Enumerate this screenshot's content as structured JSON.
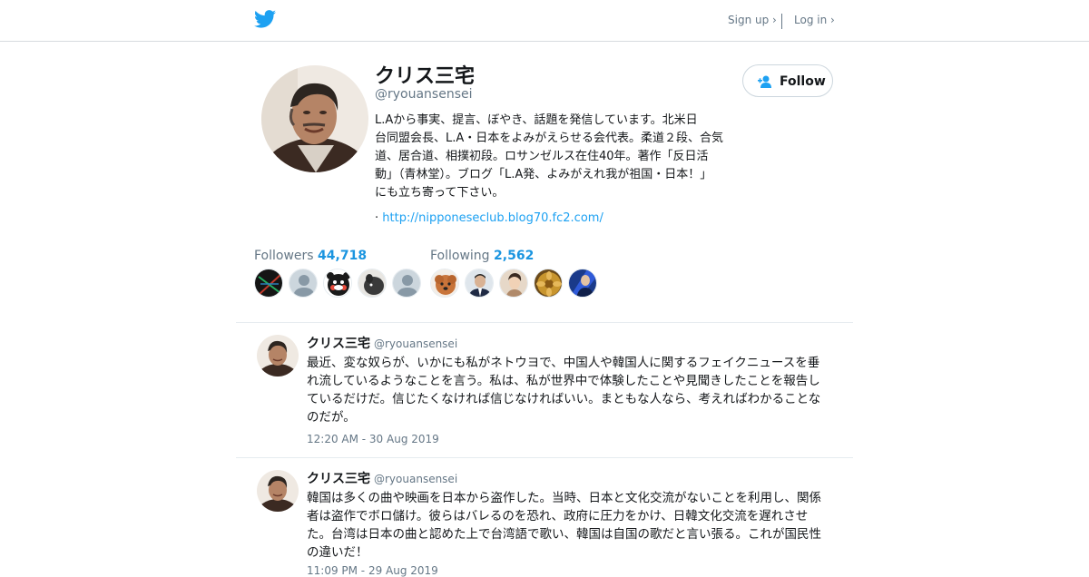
{
  "nav": {
    "signup": "Sign up ›",
    "login": "Log in ›"
  },
  "profile": {
    "name": "クリス三宅",
    "handle": "@ryouansensei",
    "follow_label": "Follow",
    "bio_lines": [
      "L.Aから事実、提言、ぼやき、話題を発信しています。北米日",
      "台同盟会長、L.A・日本をよみがえらせる会代表。柔道２段、合気",
      "道、居合道、相撲初段。ロサンゼルス在住40年。著作「反日活",
      "動」（青林堂）。ブログ「L.A発、よみがえれ我が祖国・日本！」",
      "にも立ち寄って下さい。"
    ],
    "url_prefix": "·",
    "url": "http://nipponeseclub.blog70.fc2.com/",
    "followers_label": "Followers",
    "followers_count": "44,718",
    "following_label": "Following",
    "following_count": "2,562"
  },
  "tweets": [
    {
      "name": "クリス三宅",
      "handle": "@ryouansensei",
      "lines": [
        "最近、変な奴らが、いかにも私がネトウヨで、中国人や韓国人に関するフェイクニュースを垂",
        "れ流しているようなことを言う。私は、私が世界中で体験したことや見聞きしたことを報告し",
        "ているだけだ。信じたくなければ信じなければいい。まともな人なら、考えればわかることな",
        "のだが。"
      ],
      "time": "12:20 AM - 30 Aug 2019"
    },
    {
      "name": "クリス三宅",
      "handle": "@ryouansensei",
      "lines": [
        "韓国は多くの曲や映画を日本から盗作した。当時、日本と文化交流がないことを利用し、関係",
        "者は盗作でボロ儲け。彼らはバレるのを恐れ、政府に圧力をかけ、日韓文化交流を遅れさせ",
        "た。台湾は日本の曲と認めた上で台湾語で歌い、韓国は自国の歌だと言い張る。これが国民性",
        "の違いだ！"
      ],
      "time": "11:09 PM - 29 Aug 2019"
    }
  ],
  "colors": {
    "brand": "#1da1f2",
    "link": "#1b95e0",
    "muted": "#657786"
  },
  "icons": [
    "twitter-bird-icon",
    "add-user-icon"
  ]
}
